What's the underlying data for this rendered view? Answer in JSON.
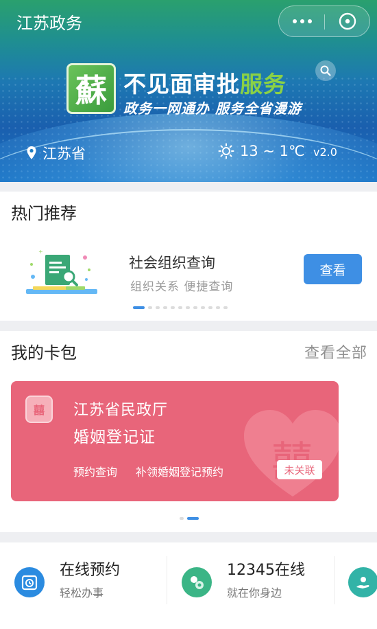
{
  "header": {
    "app_title": "江苏政务",
    "more_icon": "ellipsis-icon",
    "close_icon": "close-circle-icon"
  },
  "banner": {
    "logo_char": "蘇",
    "slogan_main_prefix": "不见面审批",
    "slogan_main_highlight": "服务",
    "slogan_sub": "政务一网通办 服务全省漫游",
    "location": "江苏省",
    "weather": "13 ~ 1℃",
    "version": "v2.0"
  },
  "hot": {
    "title": "热门推荐",
    "item_name": "社会组织查询",
    "item_desc": "组织关系  便捷查询",
    "button": "查看",
    "pages": 12,
    "active_page": 0
  },
  "wallet": {
    "title": "我的卡包",
    "view_all": "查看全部",
    "card": {
      "badge": "囍",
      "org": "江苏省民政厅",
      "cert": "婚姻登记证",
      "action1": "预约查询",
      "action2": "补领婚姻登记预约",
      "status": "未关联",
      "bg_char": "囍"
    },
    "pages": 2,
    "active_page": 1
  },
  "services": [
    {
      "title": "在线预约",
      "subtitle": "轻松办事",
      "icon": "clock-calendar-icon",
      "color": "#2b8be0"
    },
    {
      "title": "12345在线",
      "subtitle": "就在你身边",
      "icon": "chat-bubbles-icon",
      "color": "#3bb586"
    },
    {
      "title": "",
      "subtitle": "",
      "icon": "hand-service-icon",
      "color": "#32b3a7"
    }
  ],
  "colors": {
    "accent_blue": "#3e8fe4",
    "card_red": "#e8657a",
    "slogan_green": "#8ad146"
  }
}
